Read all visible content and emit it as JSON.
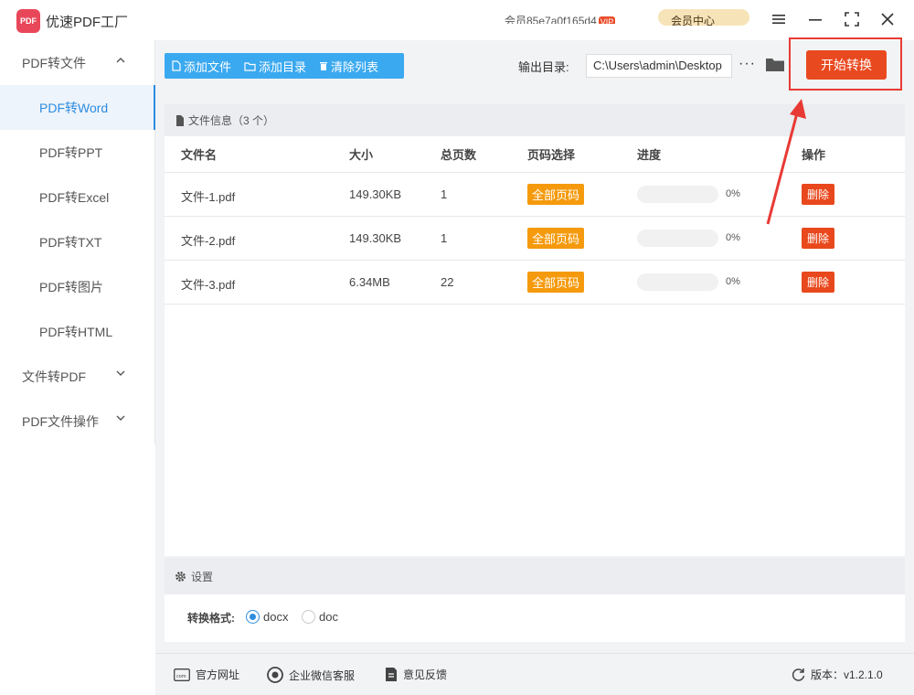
{
  "app": {
    "title": "优速PDF工厂",
    "logo_text": "PDF",
    "user_name": "会员85e7a0f165d4",
    "user_badge": "VIP",
    "member_center_label": "会员中心"
  },
  "window_controls": [
    "menu-icon",
    "minimize-icon",
    "maximize-icon",
    "close-icon"
  ],
  "sidebar": {
    "items": [
      {
        "label": "PDF转文件",
        "type": "group",
        "expanded": true
      },
      {
        "label": "PDF转Word",
        "type": "sub",
        "active": true
      },
      {
        "label": "PDF转PPT",
        "type": "sub"
      },
      {
        "label": "PDF转Excel",
        "type": "sub"
      },
      {
        "label": "PDF转TXT",
        "type": "sub"
      },
      {
        "label": "PDF转图片",
        "type": "sub"
      },
      {
        "label": "PDF转HTML",
        "type": "sub"
      },
      {
        "label": "文件转PDF",
        "type": "group",
        "expanded": false
      },
      {
        "label": "PDF文件操作",
        "type": "group",
        "expanded": false
      }
    ]
  },
  "toolbar": {
    "add_file": "添加文件",
    "add_folder": "添加目录",
    "clear_list": "清除列表",
    "output_label": "输出目录:",
    "output_path": "C:\\Users\\admin\\Desktop",
    "more_label": "···",
    "start_label": "开始转换"
  },
  "file_panel": {
    "header": "文件信息（3 个）",
    "columns": [
      "文件名",
      "大小",
      "总页数",
      "页码选择",
      "进度",
      "操作"
    ],
    "rows": [
      {
        "name": "文件-1.pdf",
        "size": "149.30KB",
        "pages": "1",
        "page_select": "全部页码",
        "progress": "0%",
        "action": "删除"
      },
      {
        "name": "文件-2.pdf",
        "size": "149.30KB",
        "pages": "1",
        "page_select": "全部页码",
        "progress": "0%",
        "action": "删除"
      },
      {
        "name": "文件-3.pdf",
        "size": "6.34MB",
        "pages": "22",
        "page_select": "全部页码",
        "progress": "0%",
        "action": "删除"
      }
    ]
  },
  "settings": {
    "header": "设置",
    "format_label": "转换格式:",
    "options": [
      {
        "label": "docx",
        "checked": true
      },
      {
        "label": "doc",
        "checked": false
      }
    ]
  },
  "footer": {
    "website": "官方网址",
    "wechat_service": "企业微信客服",
    "feedback": "意见反馈",
    "version": "版本：v1.2.1.0"
  },
  "colors": {
    "accent": "#2d8ce0",
    "toolbar_blue": "#3aa9f0",
    "start_red": "#e9491f",
    "tag_orange": "#f59a0c",
    "annotation_red": "#e83a34"
  }
}
